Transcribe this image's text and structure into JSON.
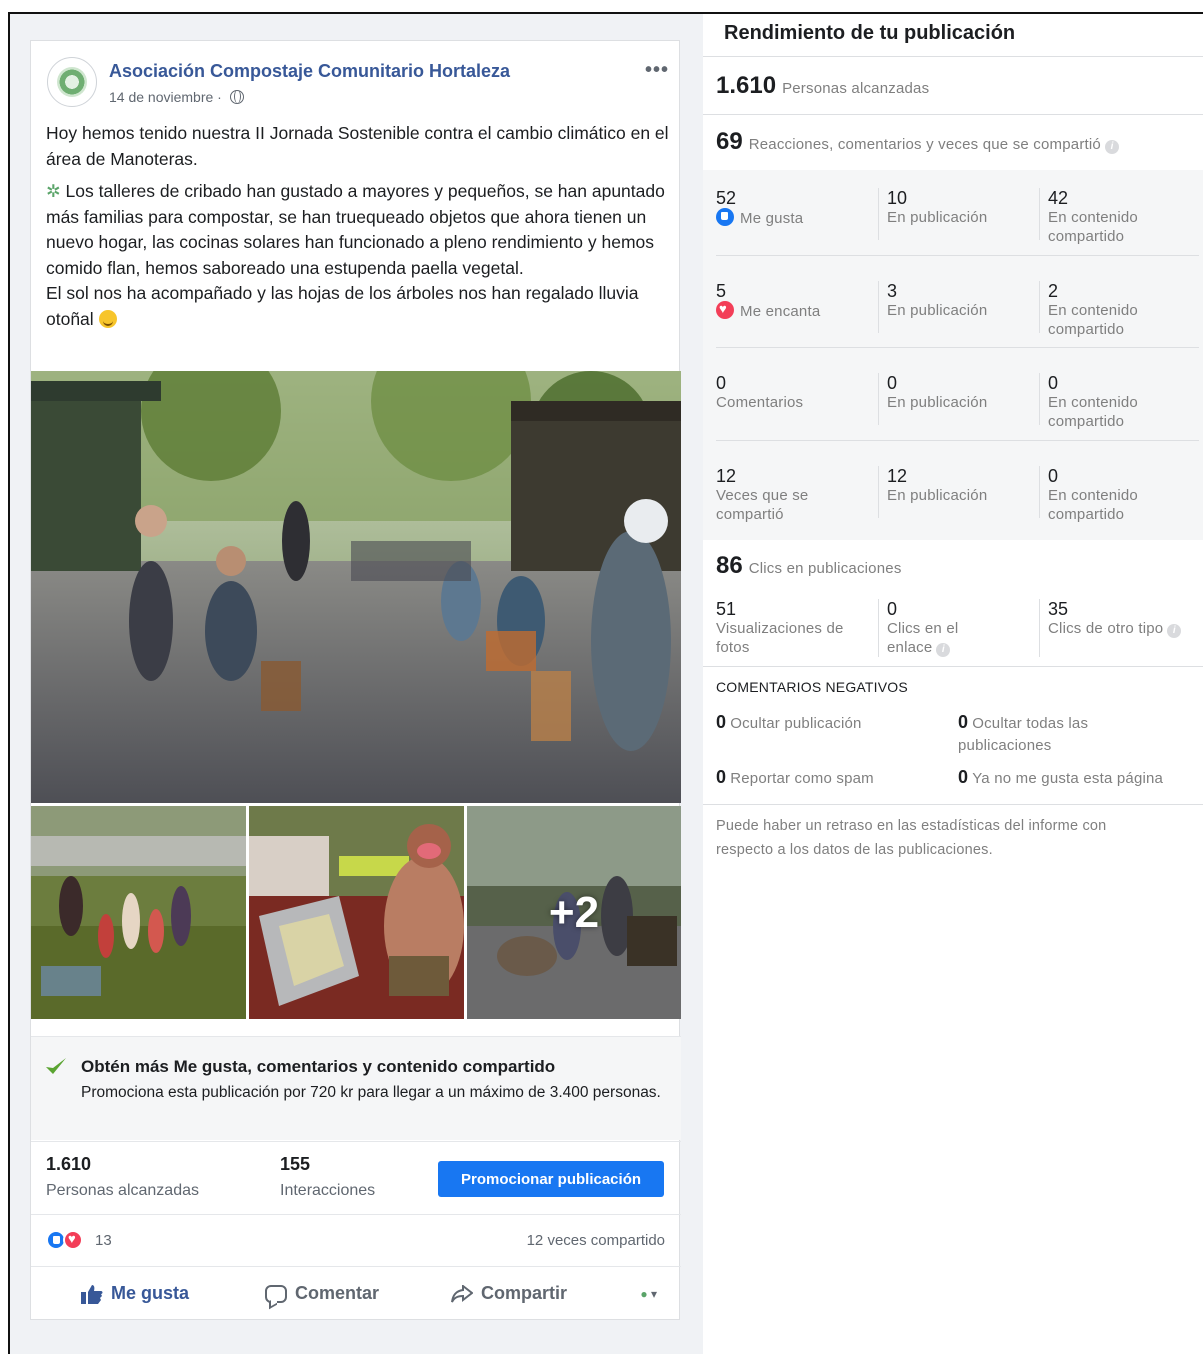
{
  "post": {
    "page_name": "Asociación Compostaje Comunitario Hortaleza",
    "date": "14 de noviembre ·",
    "paragraph_1": "Hoy hemos tenido nuestra II Jornada Sostenible contra el cambio climático en el área de Manoteras.",
    "paragraph_2": "Los talleres de cribado han gustado a mayores y pequeños, se han apuntado más familias para compostar, se han truequeado objetos que ahora tienen un nuevo hogar, las cocinas solares han funcionado a pleno rendimiento y hemos comido flan, hemos saboreado una estupenda paella vegetal.",
    "paragraph_3": "El sol nos ha acompañado y las hojas de los árboles nos han regalado lluvia otoñal",
    "more_photos": "+2",
    "promo": {
      "title": "Obtén más Me gusta, comentarios y contenido compartido",
      "description": "Promociona esta publicación por 720 kr para llegar a un máximo de 3.400 personas."
    },
    "stats": {
      "reach_value": "1.610",
      "reach_label": "Personas alcanzadas",
      "interactions_value": "155",
      "interactions_label": "Interacciones",
      "promote_label": "Promocionar publicación"
    },
    "reactions_count": "13",
    "shares_text": "12 veces compartido",
    "actions": {
      "like": "Me gusta",
      "comment": "Comentar",
      "share": "Compartir"
    }
  },
  "panel": {
    "title": "Rendimiento de tu publicación",
    "reach": {
      "value": "1.610",
      "label": "Personas alcanzadas"
    },
    "engagement": {
      "value": "69",
      "label": "Reacciones, comentarios y veces que se compartió"
    },
    "rows": [
      {
        "c1_num": "52",
        "c1_label": "Me gusta",
        "c2_num": "10",
        "c2_label": "En publicación",
        "c3_num": "42",
        "c3_label": "En contenido compartido"
      },
      {
        "c1_num": "5",
        "c1_label": "Me encanta",
        "c2_num": "3",
        "c2_label": "En publicación",
        "c3_num": "2",
        "c3_label": "En contenido compartido"
      },
      {
        "c1_num": "0",
        "c1_label": "Comentarios",
        "c2_num": "0",
        "c2_label": "En publicación",
        "c3_num": "0",
        "c3_label": "En contenido compartido"
      },
      {
        "c1_num": "12",
        "c1_label": "Veces que se compartió",
        "c2_num": "12",
        "c2_label": "En publicación",
        "c3_num": "0",
        "c3_label": "En contenido compartido"
      }
    ],
    "clicks": {
      "value": "86",
      "label": "Clics en publicaciones"
    },
    "click_rows": {
      "c1_num": "51",
      "c1_label": "Visualizaciones de fotos",
      "c2_num": "0",
      "c2_label": "Clics en el enlace",
      "c3_num": "35",
      "c3_label": "Clics de otro tipo"
    },
    "negative": {
      "heading": "COMENTARIOS NEGATIVOS",
      "hide_post_num": "0",
      "hide_post_label": "Ocultar publicación",
      "hide_all_num": "0",
      "hide_all_label": "Ocultar todas las publicaciones",
      "spam_num": "0",
      "spam_label": "Reportar como spam",
      "unlike_num": "0",
      "unlike_label": "Ya no me gusta esta página"
    },
    "disclaimer": "Puede haber un retraso en las estadísticas del informe con respecto a los datos de las publicaciones."
  },
  "colors": {
    "link_blue": "#385898",
    "button_blue": "#1877f2",
    "love_red": "#f33e58",
    "muted_text": "#7f7f7f"
  },
  "icons": [
    "globe-icon",
    "more-icon",
    "check-icon",
    "like-reaction-icon",
    "love-reaction-icon",
    "like-icon",
    "comment-icon",
    "share-icon",
    "info-icon",
    "sprout-emoji",
    "smiley-emoji"
  ]
}
